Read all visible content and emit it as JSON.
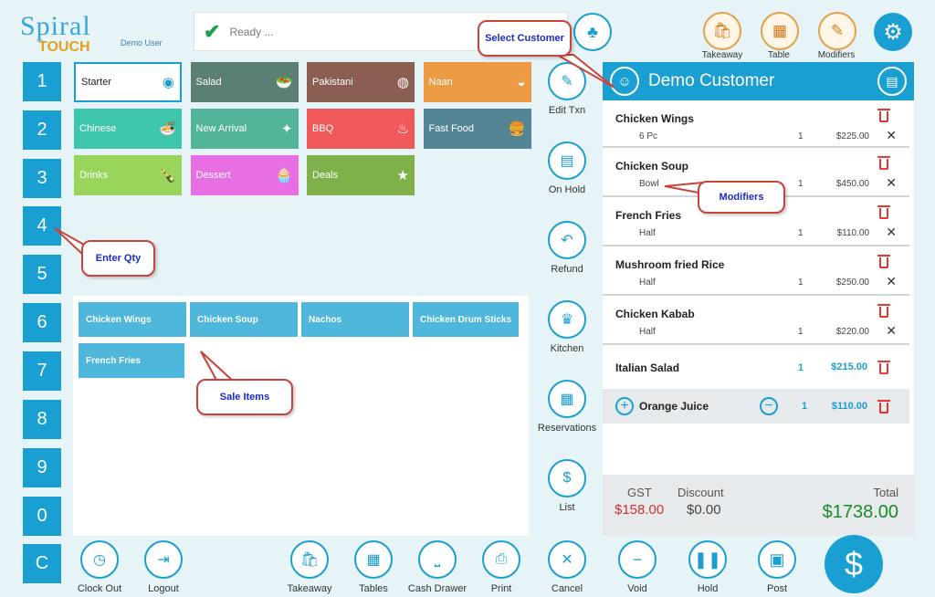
{
  "app": {
    "logo_top": "Spiral",
    "logo_bottom": "TOUCH",
    "user": "Demo User",
    "status": "Ready ..."
  },
  "colors": {
    "accent": "#1a9fd2",
    "total_green": "#1a8a2a",
    "gst_red": "#d32f2f",
    "callout_border": "#c9423b",
    "callout_text": "#1a2bc8"
  },
  "top_actions": [
    {
      "label": "Takeaway",
      "icon": "takeaway-bag-icon"
    },
    {
      "label": "Table",
      "icon": "table-icon"
    },
    {
      "label": "Modifiers",
      "icon": "modifiers-icon"
    }
  ],
  "numpad": [
    "1",
    "2",
    "3",
    "4",
    "5",
    "6",
    "7",
    "8",
    "9",
    "0",
    "C"
  ],
  "categories": [
    {
      "label": "Starter",
      "color": "#ffffff",
      "icon": "starter-icon"
    },
    {
      "label": "Salad",
      "color": "#5c7f73",
      "icon": "salad-bowl-icon"
    },
    {
      "label": "Pakistani",
      "color": "#8b5e52",
      "icon": "plate-icon"
    },
    {
      "label": "Naan",
      "color": "#ec9a44",
      "icon": "naan-icon"
    },
    {
      "label": "Chinese",
      "color": "#3fc7ae",
      "icon": "noodles-icon"
    },
    {
      "label": "New Arrival",
      "color": "#52b59a",
      "icon": "new-arrival-icon"
    },
    {
      "label": "BBQ",
      "color": "#f0595b",
      "icon": "grill-icon"
    },
    {
      "label": "Fast Food",
      "color": "#548595",
      "icon": "fast-food-icon"
    },
    {
      "label": "Drinks",
      "color": "#99d45b",
      "icon": "bottles-icon"
    },
    {
      "label": "Dessert",
      "color": "#e86ee4",
      "icon": "cupcake-icon"
    },
    {
      "label": "Deals",
      "color": "#7fb04a",
      "icon": "deals-icon"
    }
  ],
  "sale_items": [
    "Chicken Wings",
    "Chicken Soup",
    "Nachos",
    "Chicken Drum Sticks",
    "French Fries"
  ],
  "mid_actions": [
    {
      "label": "Edit Txn",
      "icon": "edit-icon"
    },
    {
      "label": "On Hold",
      "icon": "on-hold-icon"
    },
    {
      "label": "Refund",
      "icon": "refund-icon"
    },
    {
      "label": "Kitchen",
      "icon": "chef-hat-icon"
    },
    {
      "label": "Reservations",
      "icon": "calendar-icon"
    },
    {
      "label": "List",
      "icon": "money-bag-icon"
    },
    {
      "label": "Cancel",
      "icon": "close-icon"
    }
  ],
  "bottom_actions": [
    {
      "label": "Clock Out",
      "icon": "clock-icon"
    },
    {
      "label": "Logout",
      "icon": "logout-icon"
    },
    {
      "label": "Takeaway",
      "icon": "takeaway-bag-icon"
    },
    {
      "label": "Tables",
      "icon": "tables-icon"
    },
    {
      "label": "Cash Drawer",
      "icon": "cash-drawer-icon"
    },
    {
      "label": "Print",
      "icon": "printer-icon"
    }
  ],
  "customer": {
    "name": "Demo Customer"
  },
  "order": [
    {
      "name": "Chicken Wings",
      "modifier": "6 Pc",
      "qty": "1",
      "price": "$225.00"
    },
    {
      "name": "Chicken Soup",
      "modifier": "Bowl",
      "qty": "1",
      "price": "$450.00"
    },
    {
      "name": "French Fries",
      "modifier": "Half",
      "qty": "1",
      "price": "$110.00"
    },
    {
      "name": "Mushroom fried Rice",
      "modifier": "Half",
      "qty": "1",
      "price": "$250.00"
    },
    {
      "name": "Chicken Kabab",
      "modifier": "Half",
      "qty": "1",
      "price": "$220.00"
    },
    {
      "name": "Italian Salad",
      "qty": "1",
      "price": "$215.00"
    },
    {
      "name": "Orange Juice",
      "qty": "1",
      "price": "$110.00"
    }
  ],
  "totals": {
    "gst_label": "GST",
    "gst": "$158.00",
    "discount_label": "Discount",
    "discount": "$0.00",
    "total_label": "Total",
    "total": "$1738.00"
  },
  "order_actions": [
    {
      "label": "Void",
      "icon": "minus-icon"
    },
    {
      "label": "Hold",
      "icon": "pause-icon"
    },
    {
      "label": "Post",
      "icon": "save-icon"
    }
  ],
  "pay_symbol": "$",
  "callouts": {
    "select_customer": "Select Customer",
    "modifiers": "Modifiers",
    "enter_qty": "Enter Qty",
    "sale_items": "Sale Items"
  }
}
